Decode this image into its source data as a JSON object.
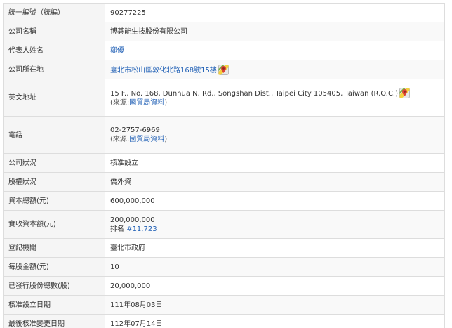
{
  "rows": [
    {
      "label": "統一編號（統編）",
      "value": "90277225"
    },
    {
      "label": "公司名稱",
      "value": "博碁能生技股份有限公司"
    },
    {
      "label": "代表人姓名",
      "value": "鄭優"
    },
    {
      "label": "公司所在地",
      "value": "臺北市松山區敦化北路168號15樓"
    },
    {
      "label": "英文地址",
      "value": "15 F., No. 168, Dunhua N. Rd., Songshan Dist., Taipei City 105405, Taiwan (R.O.C.)",
      "source_prefix": "(來源:",
      "source_link": "國貿局資料",
      "source_suffix": ")"
    },
    {
      "label": "電話",
      "value": "02-2757-6969",
      "source_prefix": "(來源:",
      "source_link": "國貿局資料",
      "source_suffix": ")"
    },
    {
      "label": "公司狀況",
      "value": "核准設立"
    },
    {
      "label": "股權狀況",
      "value": "僑外資"
    },
    {
      "label": "資本總額(元)",
      "value": "600,000,000"
    },
    {
      "label": "實收資本額(元)",
      "value": "200,000,000",
      "rank_prefix": "排名",
      "rank_link": "#11,723"
    },
    {
      "label": "登記機關",
      "value": "臺北市政府"
    },
    {
      "label": "每股金額(元)",
      "value": "10"
    },
    {
      "label": "已發行股份總數(股)",
      "value": "20,000,000"
    },
    {
      "label": "核准設立日期",
      "value": "111年08月03日"
    },
    {
      "label": "最後核准變更日期",
      "value": "112年07月14日"
    }
  ],
  "icons": {
    "map": "google-maps-icon"
  },
  "colors": {
    "link": "#1f5fb5",
    "label_bg": "#f5f5f5",
    "border": "#dddddd"
  }
}
